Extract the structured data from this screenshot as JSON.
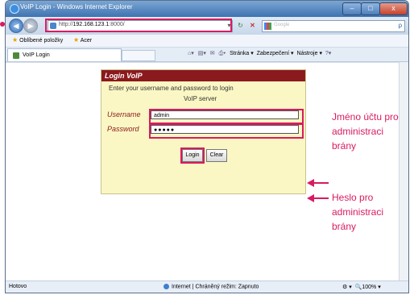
{
  "window": {
    "title": "VoIP Login - Windows Internet Explorer",
    "buttons": {
      "minimize": "–",
      "maximize": "□",
      "close": "x"
    }
  },
  "nav": {
    "back_icon": "arrow-left-icon",
    "forward_icon": "arrow-right-icon",
    "address_prefix": "http://",
    "address_host": "192.168.123.1",
    "address_suffix": ":8000/",
    "search_placeholder": "Google",
    "search_go": "ρ"
  },
  "favorites": {
    "items": [
      "Oblíbené položky",
      "Acer"
    ]
  },
  "tab": {
    "label": "VoIP Login"
  },
  "commandbar": {
    "items": [
      "Stránka ▾",
      "Zabezpečení ▾",
      "Nástroje ▾"
    ]
  },
  "login": {
    "header": "Login VoIP",
    "desc_line1": "Enter your username and password to login",
    "desc_line2": "VoIP server",
    "username_label": "Username",
    "password_label": "Password",
    "username_value": "admin",
    "password_value": "●●●●●",
    "login_button": "Login",
    "clear_button": "Clear"
  },
  "annotations": {
    "username_note": [
      "Jméno účtu pro",
      "administraci",
      "brány"
    ],
    "password_note": [
      "Heslo pro",
      "administraci",
      "brány"
    ]
  },
  "status": {
    "left": "Hotovo",
    "middle": "Internet | Chráněný režim: Zapnuto",
    "zoom": "100%"
  },
  "colors": {
    "highlight": "#d81b60",
    "login_header": "#8b1a1e",
    "login_background": "#fbf7c4"
  }
}
